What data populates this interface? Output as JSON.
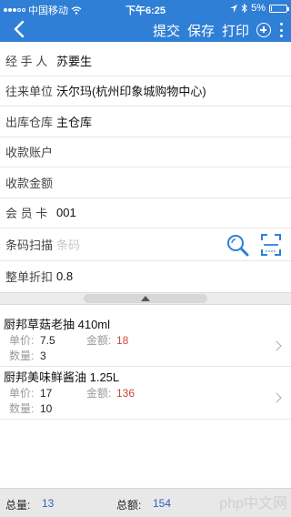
{
  "status_bar": {
    "carrier": "中国移动",
    "time": "下午6:25",
    "battery": "5%",
    "battery_level": 0.05
  },
  "nav": {
    "submit_label": "提交",
    "save_label": "保存",
    "print_label": "打印"
  },
  "form": {
    "handler": {
      "label": "经 手 人",
      "value": "苏要生"
    },
    "partner": {
      "label": "往来单位",
      "value": "沃尔玛(杭州印象城购物中心)"
    },
    "warehouse": {
      "label": "出库仓库",
      "value": "主仓库"
    },
    "account": {
      "label": "收款账户",
      "value": ""
    },
    "amount": {
      "label": "收款金额",
      "value": ""
    },
    "member": {
      "label": "会 员 卡",
      "value": "001"
    },
    "barcode": {
      "label": "条码扫描",
      "placeholder": "条码"
    },
    "discount": {
      "label": "整单折扣",
      "value": "0.8"
    }
  },
  "items": [
    {
      "name": "厨邦草菇老抽 410ml",
      "price_label": "单价:",
      "price": "7.5",
      "amount_label": "金额:",
      "amount": "18",
      "qty_label": "数量:",
      "qty": "3"
    },
    {
      "name": "厨邦美味鲜酱油 1.25L",
      "price_label": "单价:",
      "price": "17",
      "amount_label": "金额:",
      "amount": "136",
      "qty_label": "数量:",
      "qty": "10"
    }
  ],
  "footer": {
    "total_qty_label": "总量:",
    "total_qty": "13",
    "total_amount_label": "总额:",
    "total_amount": "154",
    "watermark": "php中文网"
  },
  "colors": {
    "accent": "#2f7fd6",
    "amount_red": "#c84a3a",
    "total_blue": "#2b63b8"
  }
}
